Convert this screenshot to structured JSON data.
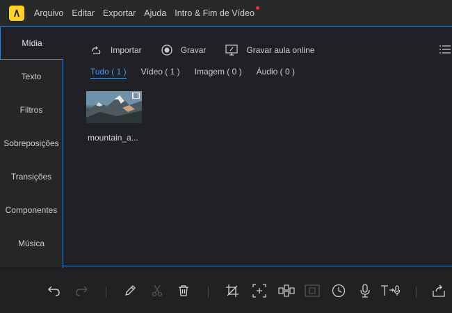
{
  "menu": {
    "items": [
      "Arquivo",
      "Editar",
      "Exportar",
      "Ajuda",
      "Intro & Fim de Vídeo"
    ]
  },
  "sidebar": {
    "items": [
      {
        "label": "Mídia",
        "active": true
      },
      {
        "label": "Texto"
      },
      {
        "label": "Filtros"
      },
      {
        "label": "Sobreposições"
      },
      {
        "label": "Transições"
      },
      {
        "label": "Componentes"
      },
      {
        "label": "Música"
      }
    ]
  },
  "toolbar": {
    "import_label": "Importar",
    "record_label": "Gravar",
    "record_class_label": "Gravar aula online"
  },
  "filters": {
    "all": "Tudo ( 1 )",
    "video": "Vídeo ( 1 )",
    "image": "Imagem ( 0 )",
    "audio": "Áudio ( 0 )"
  },
  "media": {
    "items": [
      {
        "name": "mountain_a..."
      }
    ]
  },
  "colors": {
    "accent": "#4a95e6",
    "logo": "#ffd21f",
    "notify": "#ff2b2b"
  }
}
